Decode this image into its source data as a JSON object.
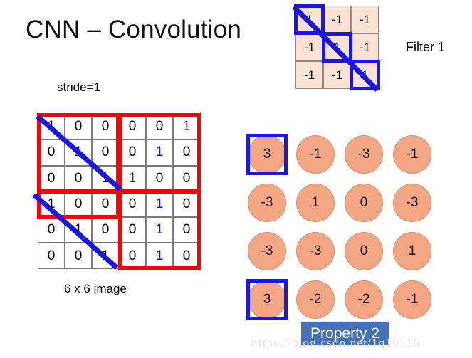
{
  "slide": {
    "title": "CNN – Convolution",
    "stride_label": "stride=1",
    "image_caption": "6 x 6 image",
    "filter_label": "Filter 1",
    "property_badge": "Property 2",
    "watermark": "https://blog.csdn.net/1q10716"
  },
  "colors": {
    "red_overlay": "#ff0000",
    "blue_overlay": "#1818e0",
    "filter_cell_bg": "#fae1d2",
    "circle_fill": "#f3a683",
    "badge_bg": "#4472b8",
    "blue_digit": "#1818e0"
  },
  "filter": {
    "rows": [
      [
        "1",
        "-1",
        "-1"
      ],
      [
        "-1",
        "1",
        "-1"
      ],
      [
        "-1",
        "-1",
        "1"
      ]
    ],
    "highlighted": [
      [
        0,
        0
      ],
      [
        1,
        1
      ],
      [
        2,
        2
      ]
    ]
  },
  "image_grid": {
    "rows": [
      [
        "1",
        "0",
        "0",
        "0",
        "0",
        "1"
      ],
      [
        "0",
        "1",
        "0",
        "0",
        "1",
        "0"
      ],
      [
        "0",
        "0",
        "1",
        "1",
        "0",
        "0"
      ],
      [
        "1",
        "0",
        "0",
        "0",
        "1",
        "0"
      ],
      [
        "0",
        "1",
        "0",
        "0",
        "1",
        "0"
      ],
      [
        "0",
        "0",
        "1",
        "0",
        "1",
        "0"
      ]
    ],
    "blue_digits": [
      [
        0,
        5
      ],
      [
        1,
        4
      ],
      [
        2,
        3
      ],
      [
        3,
        4
      ],
      [
        4,
        4
      ],
      [
        5,
        4
      ]
    ]
  },
  "output_matrix": {
    "rows": [
      [
        "3",
        "-1",
        "-3",
        "-1"
      ],
      [
        "-3",
        "1",
        "0",
        "-3"
      ],
      [
        "-3",
        "-3",
        "0",
        "1"
      ],
      [
        "3",
        "-2",
        "-2",
        "-1"
      ]
    ],
    "highlighted": [
      [
        0,
        0
      ],
      [
        3,
        0
      ]
    ]
  }
}
